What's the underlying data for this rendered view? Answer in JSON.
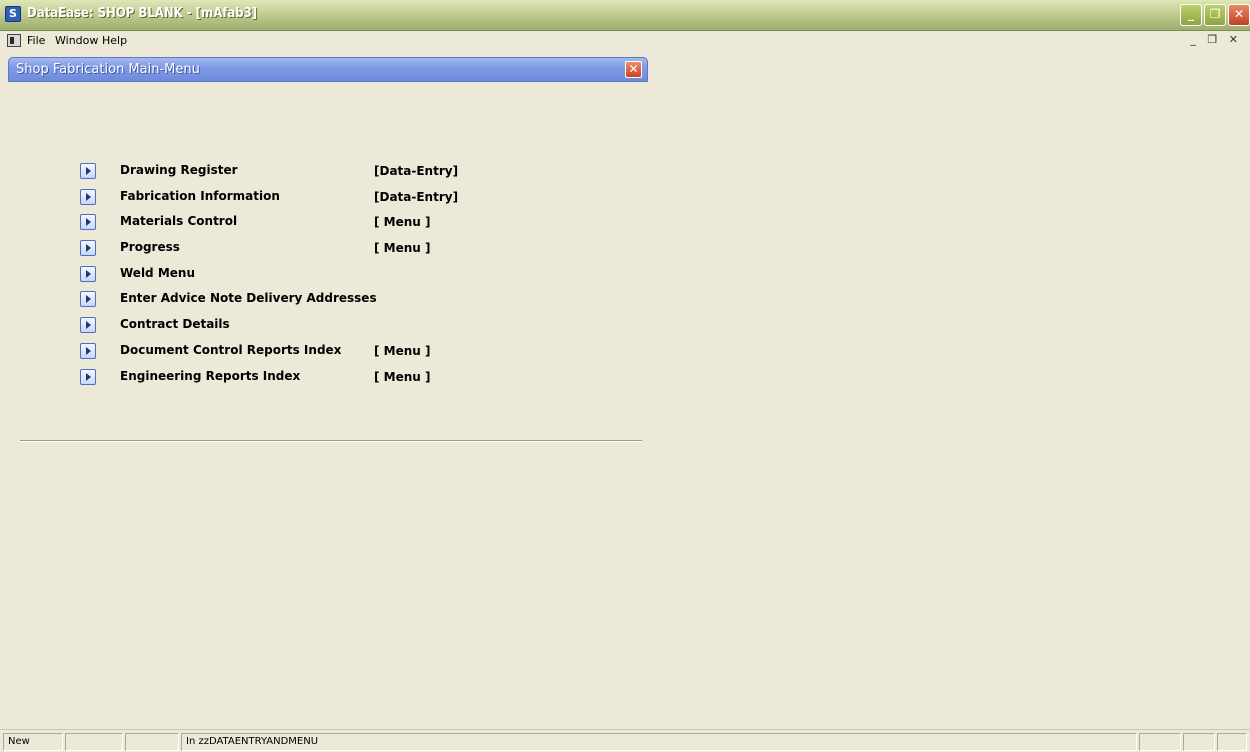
{
  "window": {
    "title": "DataEase: SHOP BLANK - [mAfab3]",
    "minimize": "_",
    "restore": "❐",
    "close": "✕"
  },
  "menubar": {
    "file": "File",
    "window": "Window",
    "help": "Help",
    "mdi_controls": "_ ❐ ✕"
  },
  "dialog": {
    "title": "Shop Fabrication Main-Menu",
    "close": "✕"
  },
  "menu": {
    "items": [
      {
        "label": "Drawing Register",
        "type": "[Data-Entry]"
      },
      {
        "label": "Fabrication Information",
        "type": "[Data-Entry]"
      },
      {
        "label": "Materials Control",
        "type": "[ Menu ]"
      },
      {
        "label": "Progress",
        "type": "[ Menu ]"
      },
      {
        "label": "Weld Menu",
        "type": ""
      },
      {
        "label": "Enter Advice Note Delivery Addresses",
        "type": ""
      },
      {
        "label": "Contract Details",
        "type": ""
      },
      {
        "label": "Document Control Reports Index",
        "type": "[ Menu ]"
      },
      {
        "label": "Engineering Reports Index",
        "type": "[ Menu ]"
      }
    ]
  },
  "status": {
    "mode": "New",
    "context": "In zzDATAENTRYANDMENU"
  },
  "colors": {
    "background": "#ece9d8",
    "title_bar": "#b4c184",
    "dialog_title": "#7f9be6",
    "close_red": "#cf4321"
  }
}
